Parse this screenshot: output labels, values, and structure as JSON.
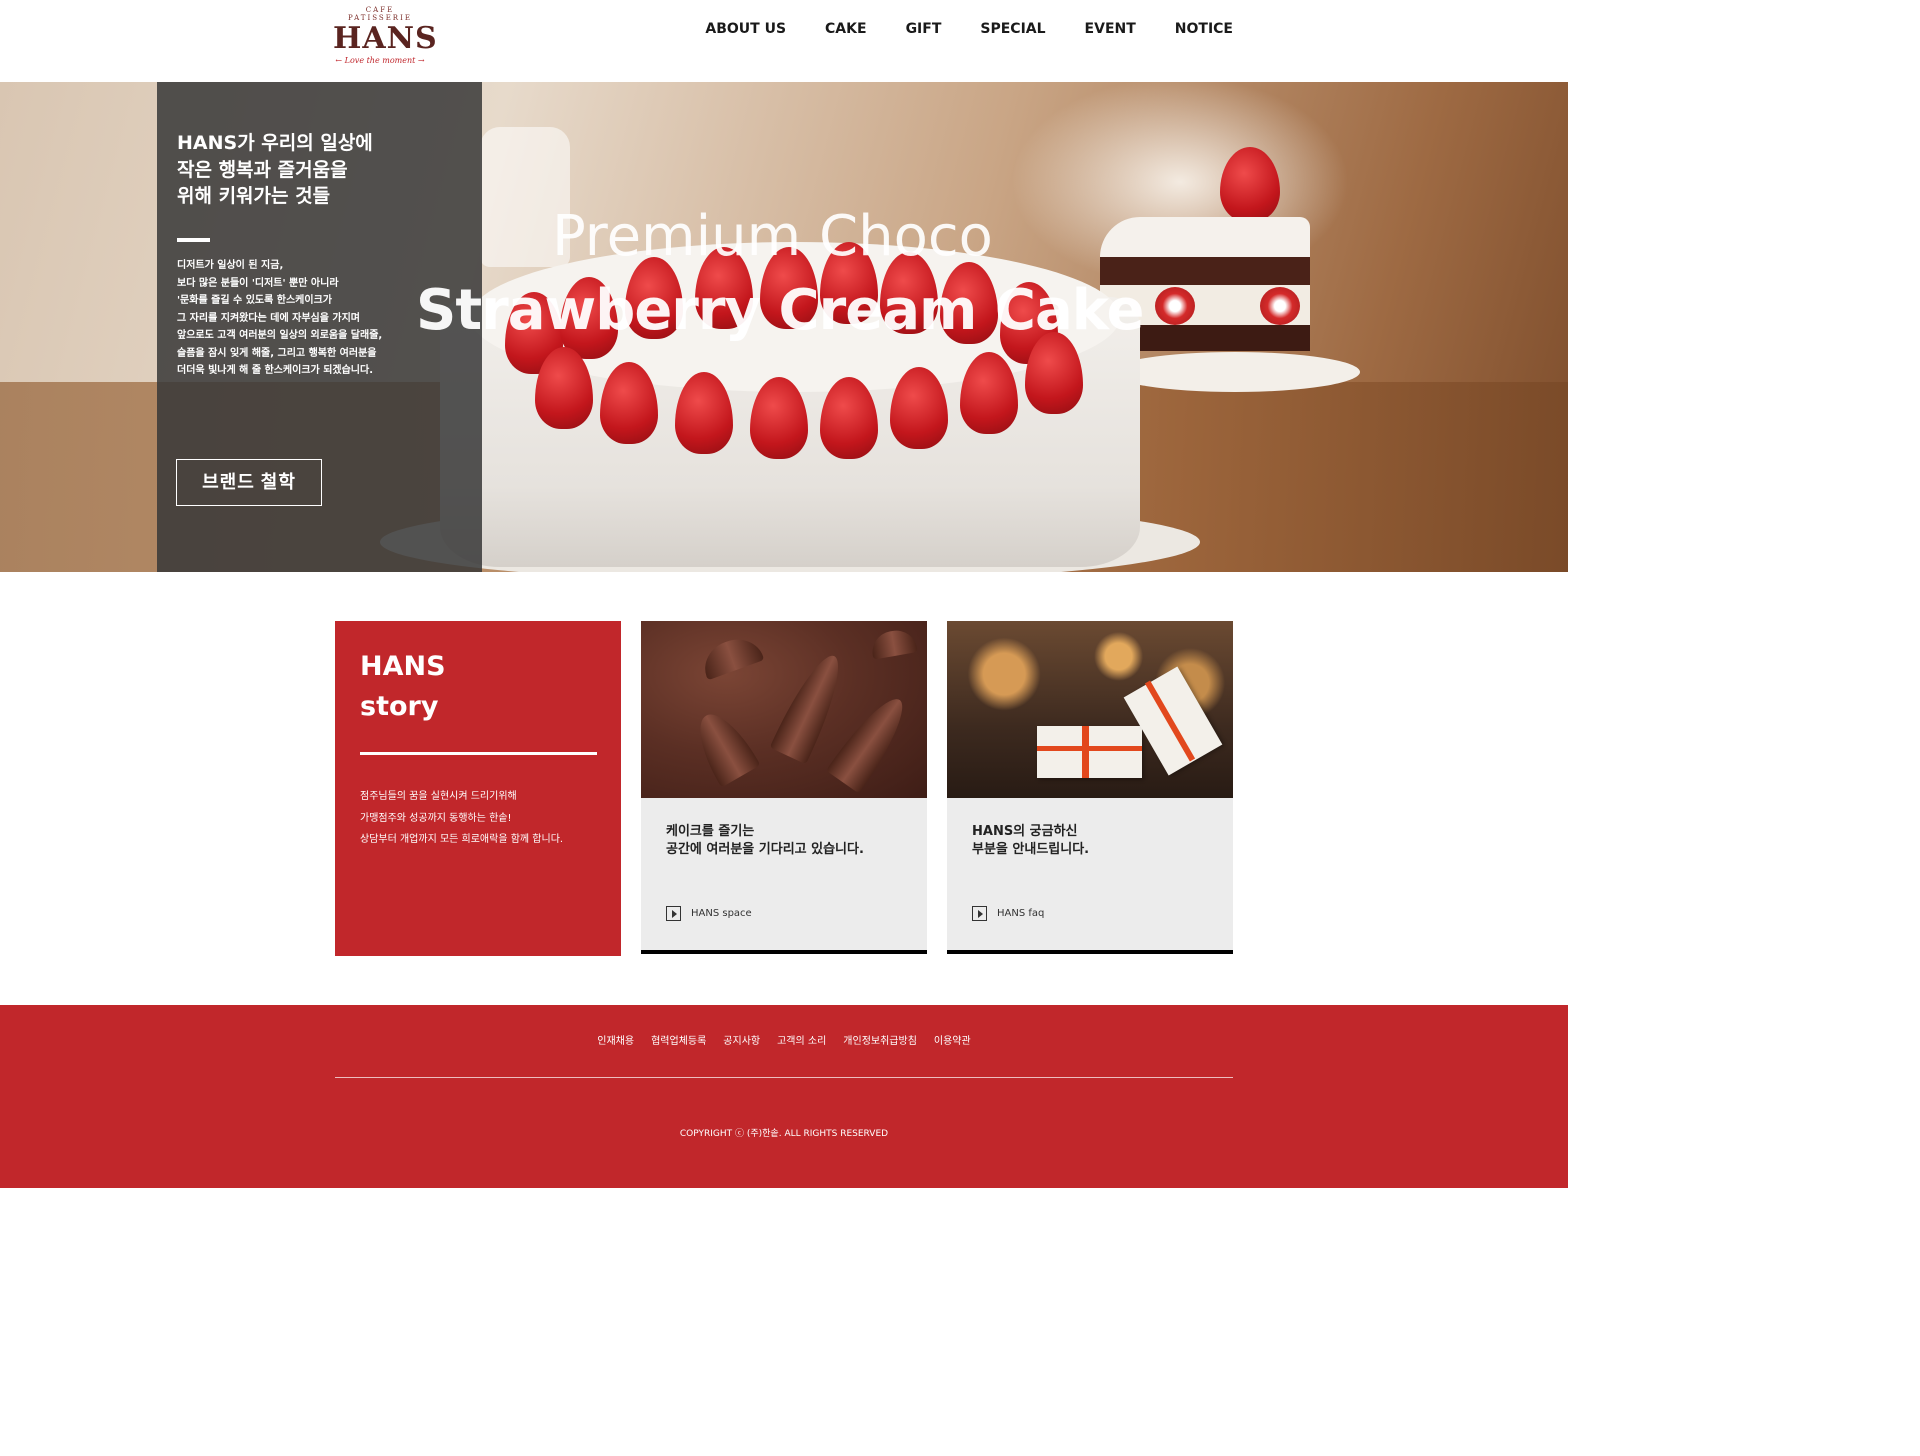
{
  "logo": {
    "cafe": "CAFE",
    "patisserie": "PATISSERIE",
    "brand": "HANS",
    "tagline": "← Love the moment →"
  },
  "nav": [
    {
      "label": "ABOUT US"
    },
    {
      "label": "CAKE"
    },
    {
      "label": "GIFT"
    },
    {
      "label": "SPECIAL"
    },
    {
      "label": "EVENT"
    },
    {
      "label": "NOTICE"
    }
  ],
  "hero": {
    "heading_lines": [
      "HANS가 우리의 일상에",
      "작은 행복과 즐거움을",
      "위해 키워가는 것들"
    ],
    "desc_lines": [
      "디저트가 일상이 된 지금,",
      "보다 많은 분들이 '디저트' 뿐만 아니라",
      "'문화를 즐길 수 있도록 한스케이크가",
      "그 자리를 지켜왔다는 데에 자부심을 가지며",
      "앞으로도 고객 여러분의 일상의 외로움을 달래줄,",
      "슬픔을 잠시 잊게 해줄, 그리고 행복한 여러분을",
      "더더욱 빛나게 해 줄 한스케이크가 되겠습니다."
    ],
    "button_label": "브랜드 철학",
    "title_line1": "Premium Choco",
    "title_line2": "Strawberry Cream Cake"
  },
  "story": {
    "title_line1": "HANS",
    "title_line2": "story",
    "text_lines": [
      "점주님들의 꿈을 실현시켜 드리기위해",
      "가맹점주와 성공까지 동행하는 한솥!",
      "상담부터 개업까지 모든 희로애락을 함께 합니다."
    ]
  },
  "cards": [
    {
      "heading_lines": [
        "케이크를 즐기는",
        "공간에 여러분을 기다리고 있습니다."
      ],
      "link_label": "HANS space"
    },
    {
      "heading_lines": [
        "HANS의 궁금하신",
        "부분을 안내드립니다."
      ],
      "link_label": "HANS faq"
    }
  ],
  "footer": {
    "links": [
      {
        "label": "인재채용"
      },
      {
        "label": "협력업체등록"
      },
      {
        "label": "공지사항"
      },
      {
        "label": "고객의 소리"
      },
      {
        "label": "개인정보취급방침"
      },
      {
        "label": "이용약관"
      }
    ],
    "copyright": "COPYRIGHT ⓒ (주)한솥. ALL RIGHTS RESERVED"
  },
  "colors": {
    "brand_red": "#c1272b",
    "panel_dark": "#373737",
    "card_gray": "#ececec"
  }
}
